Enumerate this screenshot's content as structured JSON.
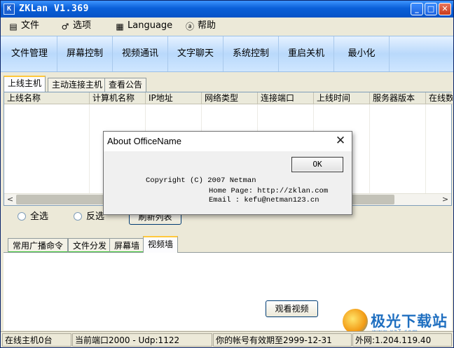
{
  "window": {
    "title": "ZKLan V1.369",
    "icon_letter": "K",
    "min": "_",
    "max": "□",
    "close": "✕"
  },
  "menu": [
    {
      "label": "文件",
      "icon": "file-menu-icon",
      "glyph": "▤"
    },
    {
      "label": "选项",
      "icon": "options-menu-icon",
      "glyph": "♂"
    },
    {
      "label": "Language",
      "icon": "language-menu-icon",
      "glyph": "▦"
    },
    {
      "label": "帮助",
      "icon": "help-menu-icon",
      "glyph": "ⓐ"
    }
  ],
  "toolbar": [
    "文件管理",
    "屏幕控制",
    "视频通讯",
    "文字聊天",
    "系统控制",
    "重启关机",
    "最小化"
  ],
  "tabs": [
    "上线主机",
    "主动连接主机",
    "查看公告"
  ],
  "columns": [
    "上线名称",
    "计算机名称",
    "IP地址",
    "网络类型",
    "连接端口",
    "上线时间",
    "服务器版本",
    "在线数"
  ],
  "scroll": {
    "left": "<",
    "right": ">"
  },
  "options": {
    "select_all": "全选",
    "invert": "反选",
    "refresh": "刷新列表"
  },
  "tabs2": [
    "常用广播命令",
    "文件分发",
    "屏幕墙",
    "视频墙"
  ],
  "watch_video": "观看视频",
  "status": {
    "online": "在线主机0台",
    "ports": "当前端口2000 - Udp:1122",
    "expiry": "你的帐号有效期至2999-12-31",
    "external": "外网:1.204.119.40"
  },
  "dialog": {
    "title": "About OfficeName",
    "close": "✕",
    "ok": "OK",
    "copyright": "Copyright (C) 2007  Netman",
    "homepage": "Home Page:  http://zklan.com",
    "email": "Email : kefu@netman123.cn"
  },
  "watermark": {
    "text": "极光下载站",
    "sub": "www.xz7.com"
  },
  "colors": {
    "accent_tab": "#ffc83c",
    "tab_underline": "#3cc83c",
    "titlebar": "#0a5fd8"
  }
}
